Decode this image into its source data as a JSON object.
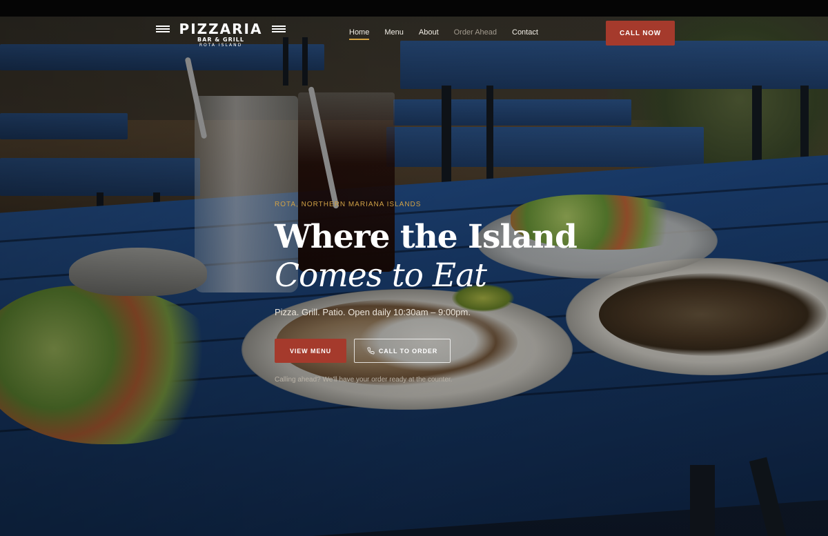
{
  "brand": {
    "name": "PIZZARIA",
    "tagline": "BAR & GRILL",
    "location": "ROTA ISLAND"
  },
  "nav": {
    "items": [
      {
        "label": "Home",
        "state": "active"
      },
      {
        "label": "Menu",
        "state": "normal"
      },
      {
        "label": "About",
        "state": "normal"
      },
      {
        "label": "Order Ahead",
        "state": "muted"
      },
      {
        "label": "Contact",
        "state": "normal"
      }
    ],
    "cta_label": "CALL NOW"
  },
  "hero": {
    "eyebrow": "ROTA, NORTHERN MARIANA ISLANDS",
    "title_line1": "Where the Island",
    "title_line2": "Comes to Eat",
    "subtitle": "Pizza. Grill. Patio. Open daily 10:30am – 9:00pm.",
    "primary_button": "VIEW MENU",
    "secondary_button": "CALL TO ORDER",
    "secondary_icon": "phone-icon",
    "note": "Calling ahead? We'll have your order ready at the counter."
  },
  "colors": {
    "accent_red": "#a53a2c",
    "accent_gold": "#d0a146",
    "nav_active_underline": "#d7a441",
    "table_blue": "#1f4a86"
  }
}
